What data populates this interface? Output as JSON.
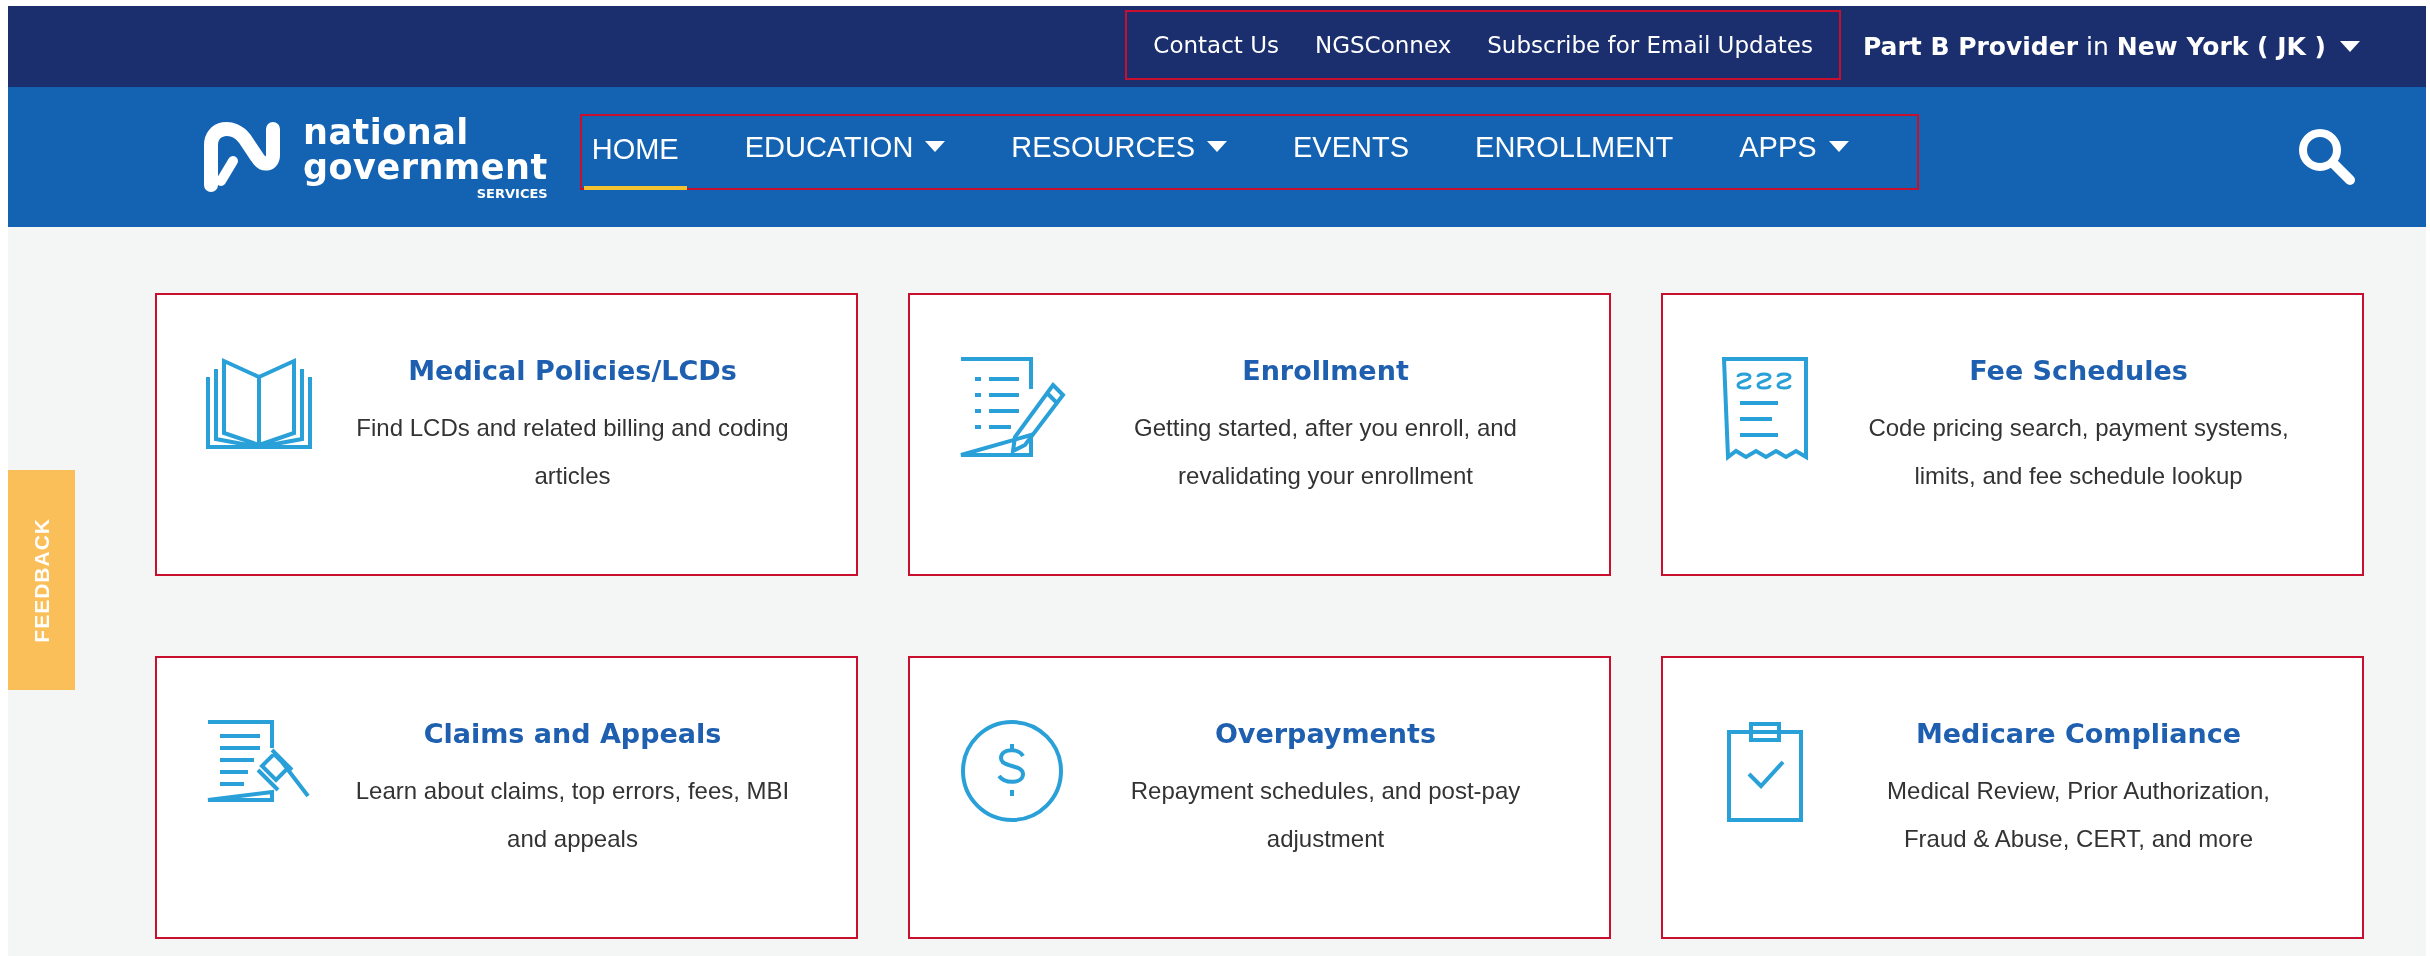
{
  "top_bar": {
    "links": [
      {
        "label": "Contact Us"
      },
      {
        "label": "NGSConnex"
      },
      {
        "label": "Subscribe for Email Updates"
      }
    ],
    "region": "**Part B Provider** in **New York ( JK )**"
  },
  "nav": {
    "logo": {
      "line1": "national",
      "line2": "government",
      "line3": "SERVICES"
    },
    "items": [
      {
        "label": "HOME",
        "selected": true,
        "has_menu": false
      },
      {
        "label": "EDUCATION",
        "selected": false,
        "has_menu": true
      },
      {
        "label": "RESOURCES",
        "selected": false,
        "has_menu": true
      },
      {
        "label": "EVENTS",
        "selected": false,
        "has_menu": false
      },
      {
        "label": "ENROLLMENT",
        "selected": false,
        "has_menu": false
      },
      {
        "label": "APPS",
        "selected": false,
        "has_menu": true
      }
    ]
  },
  "feedback": "FEEDBACK",
  "cards": [
    {
      "title": "Medical Policies/LCDs",
      "description": "Find LCDs and related billing and coding articles"
    },
    {
      "title": "Enrollment",
      "description": "Getting started, after you enroll, and revalidating your enrollment"
    },
    {
      "title": "Fee Schedules",
      "description": "Code pricing search, payment systems, limits, and fee schedule lookup"
    },
    {
      "title": "Claims and Appeals",
      "description": "Learn about claims, top errors, fees, MBI and appeals"
    },
    {
      "title": "Overpayments",
      "description": "Repayment schedules, and post-pay adjustment"
    },
    {
      "title": "Medicare Compliance",
      "description": "Medical Review, Prior Authorization, Fraud & Abuse, CERT, and more"
    }
  ]
}
